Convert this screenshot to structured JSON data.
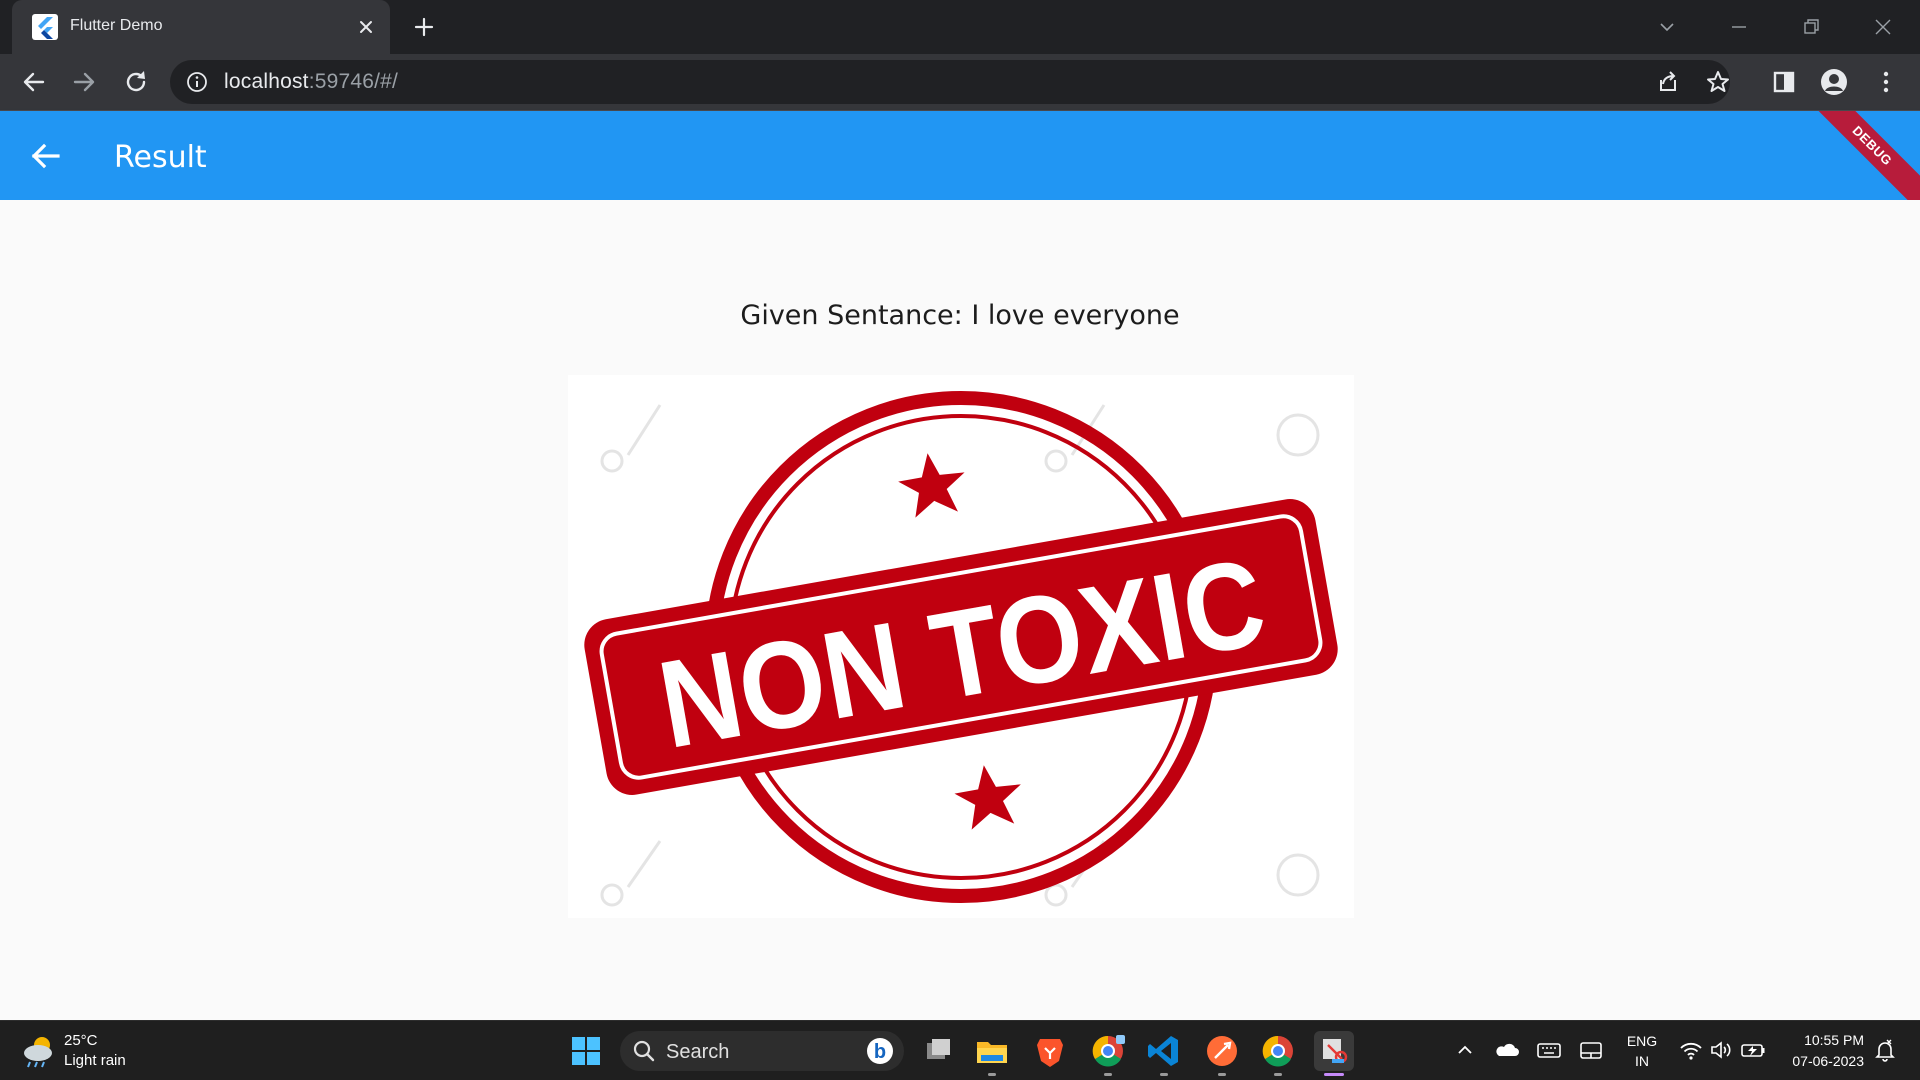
{
  "browser": {
    "tab_title": "Flutter Demo",
    "url_host": "localhost",
    "url_rest": ":59746/#/"
  },
  "app": {
    "title": "Result",
    "debug_label": "DEBUG",
    "sentence": "Given Sentance: I love everyone",
    "stamp_text": "NON TOXIC",
    "stamp_color": "#c0000f",
    "appbar_color": "#2196f3"
  },
  "taskbar": {
    "weather_temp": "25°C",
    "weather_desc": "Light rain",
    "search_label": "Search",
    "lang_line1": "ENG",
    "lang_line2": "IN",
    "time": "10:55 PM",
    "date": "07-06-2023"
  }
}
